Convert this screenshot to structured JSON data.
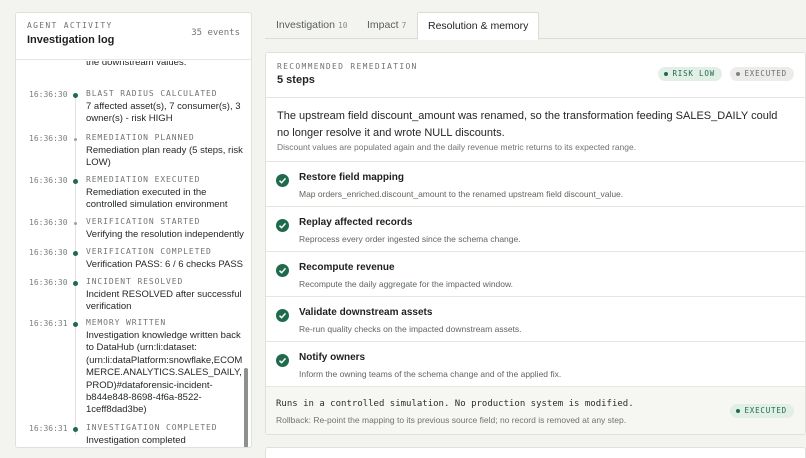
{
  "left_panel": {
    "eyebrow": "AGENT ACTIVITY",
    "title": "Investigation log",
    "count": "35 events",
    "events": [
      {
        "time": "",
        "label": "",
        "text": "the downstream values."
      },
      {
        "time": "16:36:30",
        "label": "BLAST RADIUS CALCULATED",
        "text": "7 affected asset(s), 7 consumer(s), 3 owner(s) - risk HIGH"
      },
      {
        "time": "16:36:30",
        "label": "REMEDIATION PLANNED",
        "text": "Remediation plan ready (5 steps, risk LOW)"
      },
      {
        "time": "16:36:30",
        "label": "REMEDIATION EXECUTED",
        "text": "Remediation executed in the controlled simulation environment"
      },
      {
        "time": "16:36:30",
        "label": "VERIFICATION STARTED",
        "text": "Verifying the resolution independently"
      },
      {
        "time": "16:36:30",
        "label": "VERIFICATION COMPLETED",
        "text": "Verification PASS: 6 / 6 checks PASS"
      },
      {
        "time": "16:36:30",
        "label": "INCIDENT RESOLVED",
        "text": "Incident RESOLVED after successful verification"
      },
      {
        "time": "16:36:31",
        "label": "MEMORY WRITTEN",
        "text": "Investigation knowledge written back to DataHub (urn:li:dataset:(urn:li:dataPlatform:snowflake,ECOMMERCE.ANALYTICS.SALES_DAILY,PROD)#dataforensic-incident-b844e848-8698-4f6a-8522-1ceff8dad3be)"
      },
      {
        "time": "16:36:31",
        "label": "INVESTIGATION COMPLETED",
        "text": "Investigation completed"
      }
    ]
  },
  "tabs": [
    {
      "label": "Investigation",
      "count": "10"
    },
    {
      "label": "Impact",
      "count": "7"
    },
    {
      "label": "Resolution & memory",
      "count": ""
    }
  ],
  "remediation": {
    "eyebrow": "RECOMMENDED REMEDIATION",
    "title": "5 steps",
    "risk_badge": "RISK LOW",
    "status_badge": "EXECUTED",
    "summary": "The upstream field discount_amount was renamed, so the transformation feeding SALES_DAILY could no longer resolve it and wrote NULL discounts.",
    "outcome": "Discount values are populated again and the daily revenue metric returns to its expected range.",
    "steps": [
      {
        "title": "Restore field mapping",
        "desc": "Map orders_enriched.discount_amount to the renamed upstream field discount_value."
      },
      {
        "title": "Replay affected records",
        "desc": "Reprocess every order ingested since the schema change."
      },
      {
        "title": "Recompute revenue",
        "desc": "Recompute the daily aggregate for the impacted window."
      },
      {
        "title": "Validate downstream assets",
        "desc": "Re-run quality checks on the impacted downstream assets."
      },
      {
        "title": "Notify owners",
        "desc": "Inform the owning teams of the schema change and of the applied fix."
      }
    ],
    "footer": {
      "simulation_note": "Runs in a controlled simulation. No production system is modified.",
      "rollback": "Rollback: Re-point the mapping to its previous source field; no record is removed at any step.",
      "badge": "EXECUTED"
    }
  },
  "colors": {
    "accent": "#1f6a4d",
    "badge_bg": "#e2efe7",
    "background": "#f3f3ef"
  }
}
